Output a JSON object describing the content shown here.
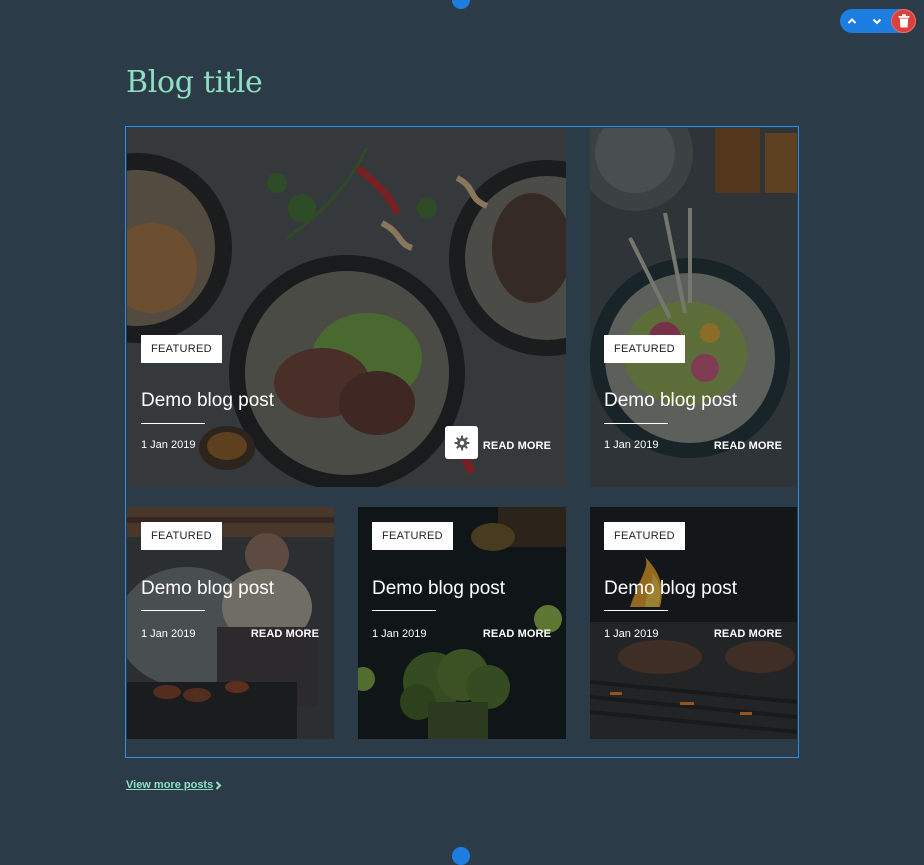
{
  "blog": {
    "title": "Blog title",
    "view_more": "View more posts"
  },
  "posts": [
    {
      "badge": "FEATURED",
      "title": "Demo blog post",
      "date": "1 Jan 2019",
      "read_more": "READ MORE"
    },
    {
      "badge": "FEATURED",
      "title": "Demo blog post",
      "date": "1 Jan 2019",
      "read_more": "READ MORE"
    },
    {
      "badge": "FEATURED",
      "title": "Demo blog post",
      "date": "1 Jan 2019",
      "read_more": "READ MORE"
    },
    {
      "badge": "FEATURED",
      "title": "Demo blog post",
      "date": "1 Jan 2019",
      "read_more": "READ MORE"
    },
    {
      "badge": "FEATURED",
      "title": "Demo blog post",
      "date": "1 Jan 2019",
      "read_more": "READ MORE"
    }
  ],
  "icons": {
    "move_up": "chevron-up-icon",
    "move_down": "chevron-down-icon",
    "delete": "trash-icon",
    "settings": "gear-icon",
    "view_more_arrow": "chevron-right-icon"
  },
  "colors": {
    "background": "#2c3b48",
    "accent": "#1e7de0",
    "title": "#8ee0c2",
    "delete": "#d9413e"
  }
}
